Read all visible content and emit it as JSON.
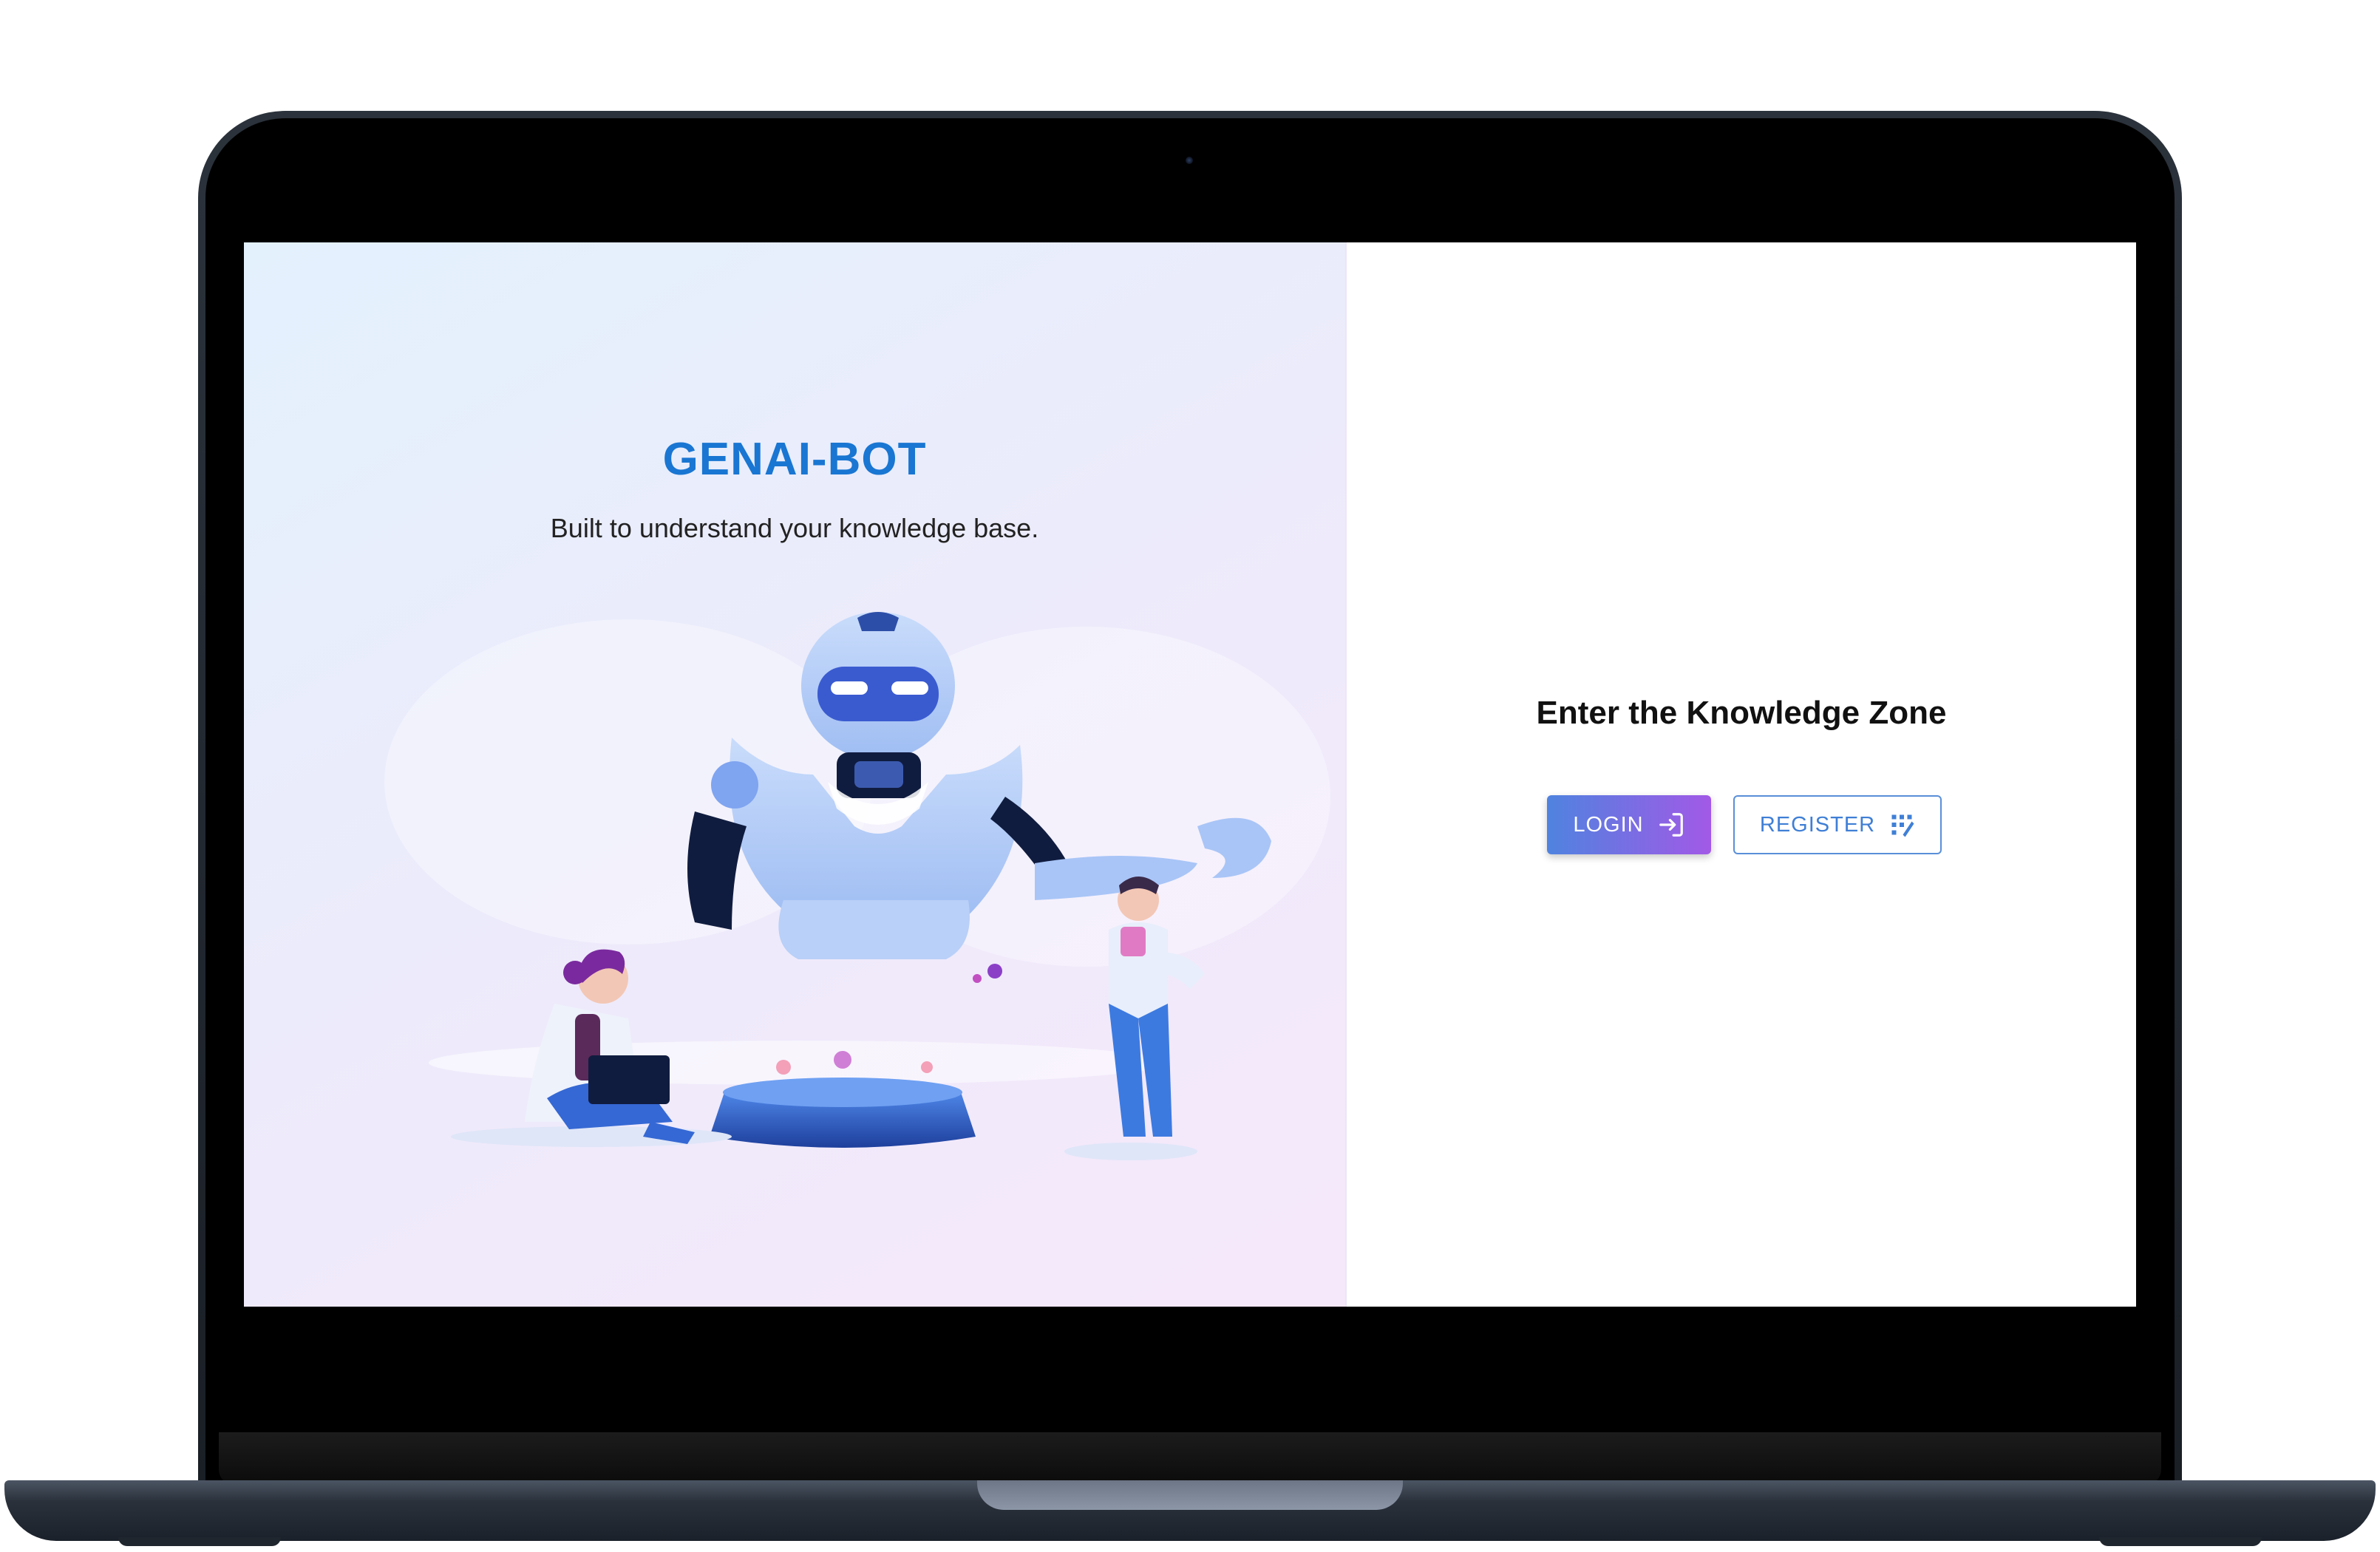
{
  "left_panel": {
    "title": "GENAI-BOT",
    "subtitle": "Built to understand your knowledge base."
  },
  "right_panel": {
    "heading": "Enter the Knowledge Zone",
    "login_label": "LOGIN",
    "register_label": "REGISTER"
  },
  "icons": {
    "login": "login-icon",
    "register": "register-icon"
  },
  "colors": {
    "brand": "#1976d2",
    "login_gradient_start": "#4f83e0",
    "login_gradient_end": "#a259e6",
    "register_outline": "#5a8fd9"
  }
}
